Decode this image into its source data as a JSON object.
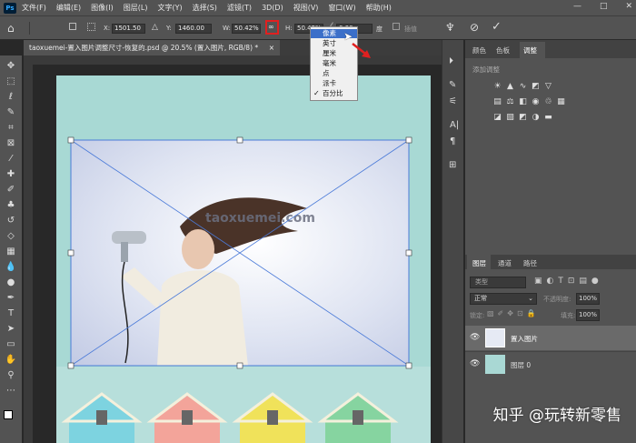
{
  "menubar": {
    "app_logo": "Ps",
    "items": [
      "文件(F)",
      "编辑(E)",
      "图像(I)",
      "图层(L)",
      "文字(Y)",
      "选择(S)",
      "滤镜(T)",
      "3D(D)",
      "视图(V)",
      "窗口(W)",
      "帮助(H)"
    ],
    "window_controls": [
      "—",
      "□",
      "✕"
    ]
  },
  "options": {
    "x_label": "X:",
    "x_value": "1501.50",
    "y_label": "Y:",
    "y_value": "1460.00",
    "w_label": "W:",
    "w_value": "50.42%",
    "h_label": "H:",
    "h_value": "50.42%",
    "angle_value": "0.00",
    "angle_unit": "度",
    "interp_label": "插值",
    "link_icon": "link-icon",
    "link_highlight_color": "#e02020"
  },
  "document": {
    "tab_title": "taoxuemei-置入图片调整尺寸-恢复的.psd @ 20.5% (置入图片, RGB/8) *",
    "close_glyph": "×",
    "watermark_text": "taoxuemei.com"
  },
  "unit_dropdown": {
    "items": [
      "像素",
      "英寸",
      "厘米",
      "毫米",
      "点",
      "派卡",
      "百分比"
    ],
    "selected_index": 0,
    "checked_index": 6,
    "highlight_color": "#3b6fc9"
  },
  "panels": {
    "top_tabs": [
      "颜色",
      "色板",
      "调整"
    ],
    "active_top_tab": 2,
    "adjust_title": "添加调整",
    "layers_tabs": [
      "图层",
      "通道",
      "路径"
    ],
    "kind_label": "类型",
    "blend_mode": "正常",
    "opacity_label": "不透明度:",
    "opacity_value": "100%",
    "lock_label": "锁定:",
    "fill_label": "填充:",
    "fill_value": "100%",
    "layers": [
      {
        "name": "置入图片",
        "selected": true
      },
      {
        "name": "图层 0",
        "selected": false
      }
    ]
  },
  "overlay": {
    "zhihu_text": "知乎 @玩转新零售"
  }
}
